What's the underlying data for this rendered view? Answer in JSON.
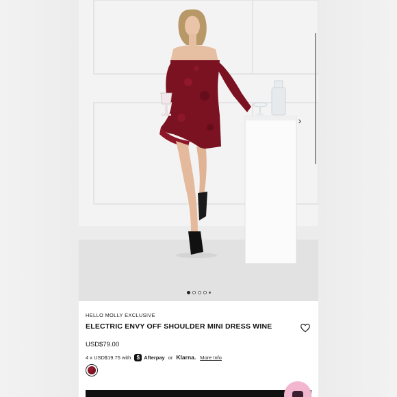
{
  "gallery": {
    "image_description_icon": "product-photo",
    "next_icon": "chevron-right-icon",
    "dots": [
      {
        "active": true
      },
      {
        "active": false
      },
      {
        "active": false
      },
      {
        "active": false
      },
      {
        "small": true
      }
    ]
  },
  "product": {
    "eyebrow": "HELLO MOLLY EXCLUSIVE",
    "title": "ELECTRIC ENVY OFF SHOULDER MINI DRESS WINE",
    "price": "USD$79.00",
    "installments_prefix": "4 x USD$19.75 with",
    "afterpay_mark": "$",
    "afterpay_label": "Afterpay",
    "or_text": "or",
    "klarna_label": "Klarna.",
    "more_info": "More Info",
    "wishlist_icon": "heart-icon"
  },
  "colors": {
    "swatch": "#8a1426",
    "chat_bubble": "#f2b6cf"
  }
}
